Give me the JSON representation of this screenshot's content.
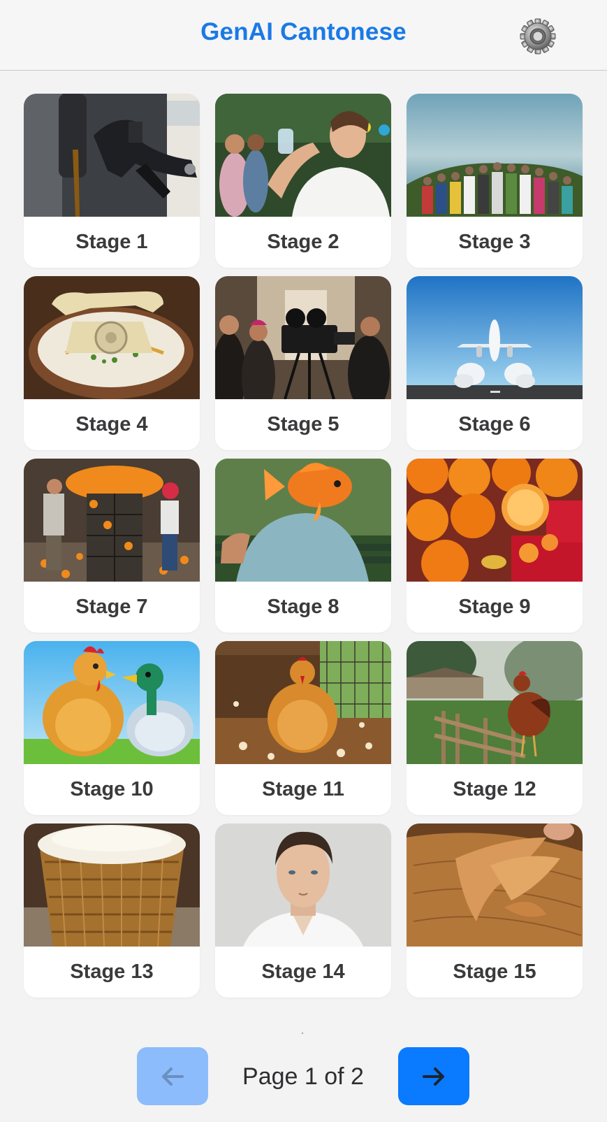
{
  "header": {
    "title": "GenAI Cantonese",
    "settings_icon": "gear-icon"
  },
  "stages": [
    {
      "label": "Stage 1",
      "image": "fuel-nozzle-pumping-gas"
    },
    {
      "label": "Stage 2",
      "image": "young-man-drinking-water-at-party"
    },
    {
      "label": "Stage 3",
      "image": "group-photo-by-the-sea"
    },
    {
      "label": "Stage 4",
      "image": "rotary-phone-in-congee-bowl"
    },
    {
      "label": "Stage 5",
      "image": "film-crew-with-camera"
    },
    {
      "label": "Stage 6",
      "image": "airplane-taking-off-runway"
    },
    {
      "label": "Stage 7",
      "image": "orange-market-crates"
    },
    {
      "label": "Stage 8",
      "image": "goldfish-head-man-on-bench"
    },
    {
      "label": "Stage 9",
      "image": "mandarin-oranges-red-envelopes"
    },
    {
      "label": "Stage 10",
      "image": "cartoon-chicken-and-duck"
    },
    {
      "label": "Stage 11",
      "image": "hen-in-coop-with-feathers"
    },
    {
      "label": "Stage 12",
      "image": "rooster-by-fence-misty-farm"
    },
    {
      "label": "Stage 13",
      "image": "woven-basket-of-rice"
    },
    {
      "label": "Stage 14",
      "image": "portrait-of-man-white-shirt"
    },
    {
      "label": "Stage 15",
      "image": "wood-shavings-log"
    }
  ],
  "pagination": {
    "label": "Page 1 of 2",
    "current": 1,
    "total": 2,
    "prev_icon": "arrow-left-icon",
    "next_icon": "arrow-right-icon"
  },
  "colors": {
    "accent": "#1a7ae6",
    "button_primary": "#0a7aff",
    "button_disabled": "#8cbcfb"
  }
}
